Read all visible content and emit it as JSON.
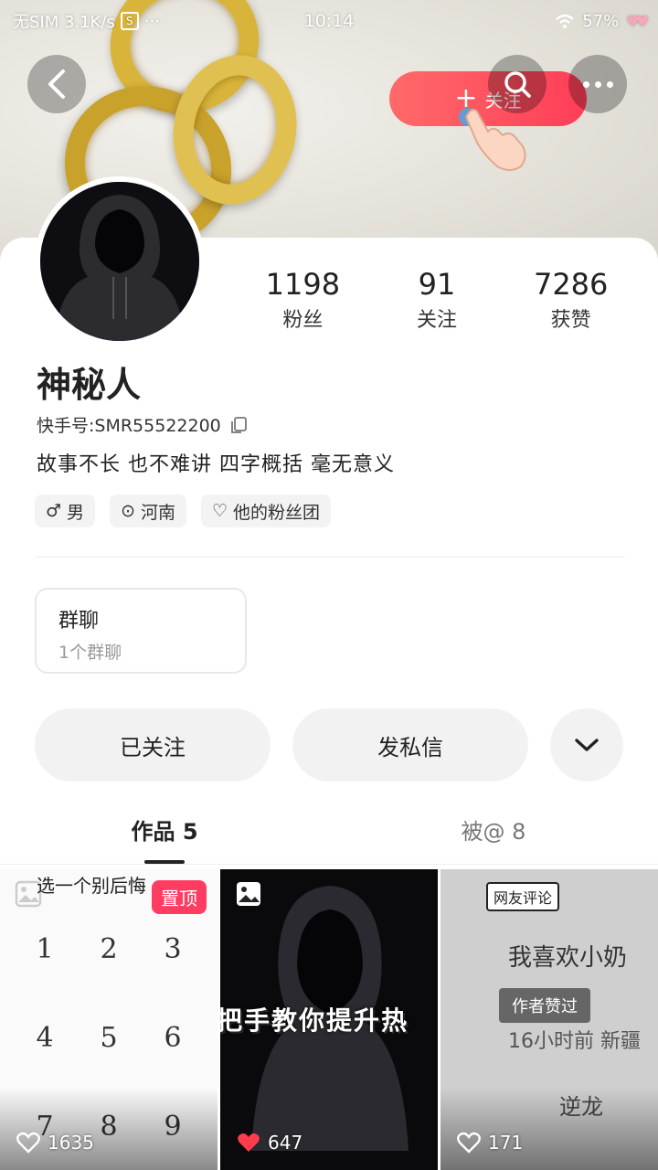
{
  "status_bar": {
    "carrier": "无SIM 3.1K/s",
    "s_icon_label": "S",
    "time": "10:14",
    "battery": "57%"
  },
  "header": {
    "follow_button": "关注",
    "follow_plus": "+"
  },
  "profile": {
    "name": "神秘人",
    "kuaishou_id": "快手号:SMR55522200",
    "bio": "故事不长 也不难讲 四字概括 毫无意义",
    "stats": [
      {
        "value": "1198",
        "label": "粉丝"
      },
      {
        "value": "91",
        "label": "关注"
      },
      {
        "value": "7286",
        "label": "获赞"
      }
    ],
    "tags": [
      {
        "icon": "male-icon",
        "symbol": "♂",
        "label": "男"
      },
      {
        "icon": "location-icon",
        "symbol": "⊙",
        "label": "河南"
      },
      {
        "icon": "heart-outline-icon",
        "symbol": "♡",
        "label": "他的粉丝团"
      }
    ]
  },
  "group_card": {
    "title": "群聊",
    "subtitle": "1个群聊"
  },
  "actions": {
    "followed": "已关注",
    "message": "发私信"
  },
  "tabs": [
    {
      "label": "作品 5",
      "active": true
    },
    {
      "label": "被@ 8",
      "active": false
    }
  ],
  "grid": [
    {
      "caption": "选一个别后悔",
      "pin": "置顶",
      "likes": "1635",
      "numbers": [
        "1",
        "2",
        "3",
        "4",
        "5",
        "6",
        "7",
        "8",
        "9"
      ]
    },
    {
      "overlay_text": "把手教你提升热",
      "likes": "647"
    },
    {
      "badge": "网友评论",
      "headline": "我喜欢小奶",
      "chip": "作者赞过",
      "meta": "16小时前 新疆",
      "author": "逆龙",
      "likes": "171"
    }
  ],
  "colors": {
    "accent": "#ff3d57",
    "pin": "#ff3d63",
    "like_red": "#ff3b4e"
  }
}
